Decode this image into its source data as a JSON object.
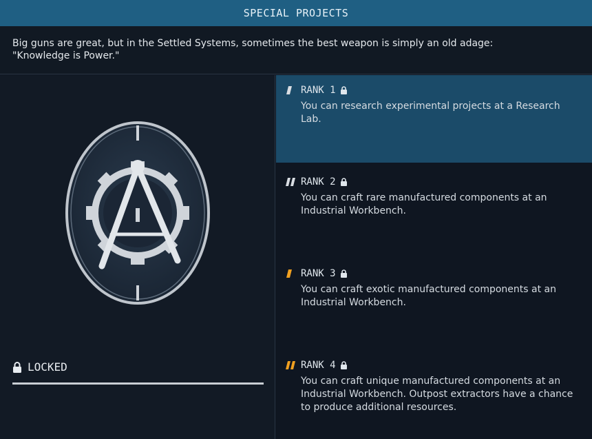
{
  "header": {
    "title": "SPECIAL PROJECTS"
  },
  "description": {
    "line1": "Big guns are great, but in the Settled Systems, sometimes the best weapon is simply an old adage:",
    "line2": "\"Knowledge is Power.\""
  },
  "status": {
    "label": "LOCKED",
    "icon": "lock-icon"
  },
  "colors": {
    "header_bg": "#1f5f83",
    "active_rank_bg": "#1b4b69",
    "rank_mark_white": "#d9dde2",
    "rank_mark_orange": "#f0a020"
  },
  "ranks": [
    {
      "label": "RANK 1",
      "desc": "You can research experimental projects at a Research Lab.",
      "locked": true,
      "active": true
    },
    {
      "label": "RANK 2",
      "desc": "You can craft rare manufactured components at an Industrial Workbench.",
      "locked": true,
      "active": false
    },
    {
      "label": "RANK 3",
      "desc": "You can craft exotic manufactured components at an Industrial Workbench.",
      "locked": true,
      "active": false
    },
    {
      "label": "RANK 4",
      "desc": "You can craft unique manufactured components at an Industrial Workbench. Outpost extractors have a chance to produce additional resources.",
      "locked": true,
      "active": false
    }
  ]
}
